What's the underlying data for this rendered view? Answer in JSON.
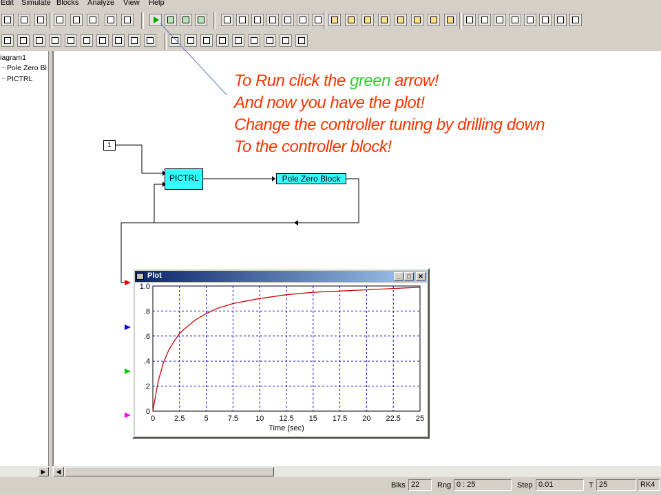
{
  "menu": [
    "Edit",
    "Simulate",
    "Blocks",
    "Analyze",
    "View",
    "Help"
  ],
  "tree": {
    "root": "iagram1",
    "items": [
      "Pole Zero Bl",
      "PICTRL"
    ]
  },
  "note": {
    "line1_a": "To Run click the ",
    "line1_green": "green",
    "line1_b": " arrow!",
    "line2": "And now you have the plot!",
    "line3": "Change the controller tuning by drilling down",
    "line4": "To the controller block!"
  },
  "diagram": {
    "const_value": "1",
    "pictrl_label": "PICTRL",
    "polezero_label": "Pole Zero Block"
  },
  "plot_window": {
    "title": "Plot",
    "btn_minimize": "_",
    "btn_maximize": "□",
    "btn_close": "✕"
  },
  "colors": {
    "note_text": "#ff3300",
    "note_green": "#33cc33",
    "block_fill": "#33ffff",
    "curve": "#cc0000",
    "grid": "#0000cc",
    "input_arrows": [
      "#ff0000",
      "#0000ff",
      "#00cc00",
      "#ff00ff"
    ]
  },
  "chart_data": {
    "type": "line",
    "xlabel": "Time (sec)",
    "ylabel": "",
    "xlim": [
      0,
      25
    ],
    "ylim": [
      0,
      1.0
    ],
    "x_ticks": [
      "0",
      "2.5",
      "5",
      "7.5",
      "10",
      "12.5",
      "15",
      "17.5",
      "20",
      "22.5",
      "25"
    ],
    "y_ticks": [
      "0",
      ".2",
      ".4",
      ".6",
      ".8",
      "1.0"
    ],
    "grid": true,
    "series": [
      {
        "x": [
          0,
          0.5,
          1,
          1.5,
          2,
          2.5,
          3,
          4,
          5,
          6,
          7.5,
          10,
          12.5,
          15,
          17.5,
          20,
          22.5,
          25
        ],
        "values": [
          0,
          0.24,
          0.39,
          0.49,
          0.56,
          0.62,
          0.66,
          0.73,
          0.78,
          0.82,
          0.86,
          0.9,
          0.93,
          0.95,
          0.96,
          0.97,
          0.98,
          0.99
        ]
      }
    ]
  },
  "status": {
    "blks_label": "Blks",
    "blks_value": "22",
    "rng_label": "Rng",
    "rng_value": "0 : 25",
    "step_label": "Step",
    "step_value": "0.01",
    "t_label": "T",
    "t_value": "25",
    "method": "RK4"
  }
}
